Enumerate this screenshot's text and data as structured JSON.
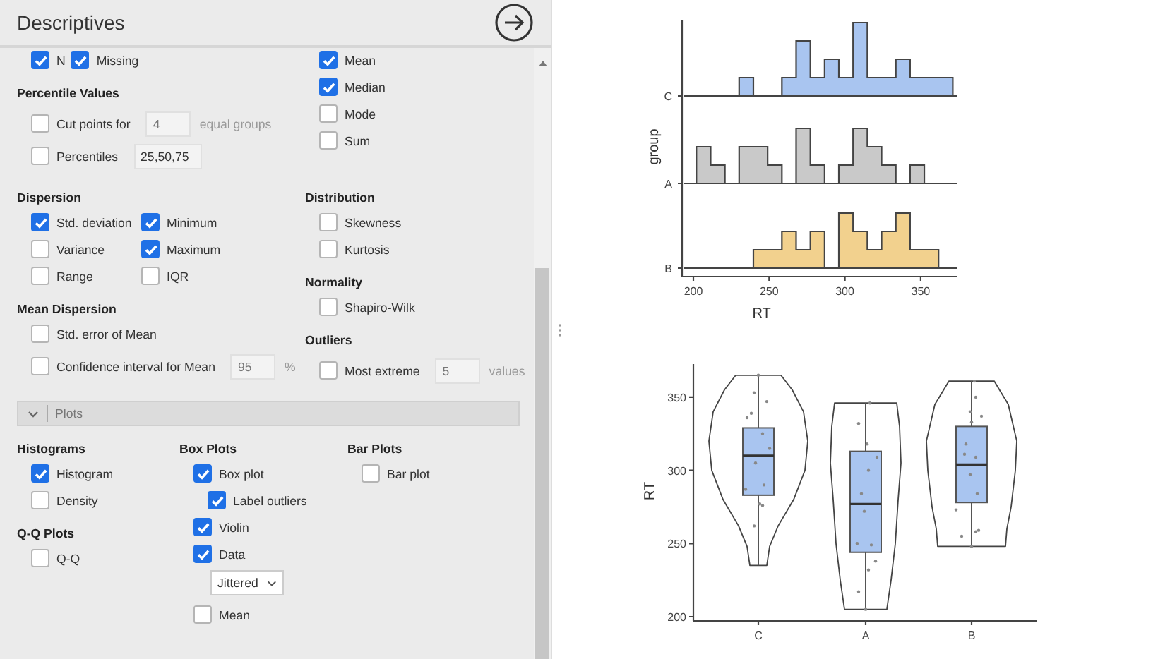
{
  "panel": {
    "title": "Descriptives",
    "option_groups": [
      {
        "columns": [
          [
            {
              "kind": "inline",
              "checks": [
                {
                  "label": "N",
                  "checked": true
                },
                {
                  "label": "Missing",
                  "checked": true
                }
              ]
            },
            {
              "kind": "heading",
              "label": "Percentile Values"
            },
            {
              "kind": "check",
              "label": "Cut points for",
              "checked": false,
              "field": {
                "value": "4",
                "disabled": true
              },
              "suffix": "equal groups"
            },
            {
              "kind": "check",
              "label": "Percentiles",
              "checked": false,
              "field": {
                "value": "25,50,75",
                "disabled": false
              }
            }
          ],
          [
            {
              "kind": "check",
              "label": "Mean",
              "checked": true
            },
            {
              "kind": "check",
              "label": "Median",
              "checked": true
            },
            {
              "kind": "check",
              "label": "Mode",
              "checked": false
            },
            {
              "kind": "check",
              "label": "Sum",
              "checked": false
            }
          ]
        ]
      },
      {
        "columns": [
          [
            {
              "kind": "heading",
              "label": "Dispersion"
            },
            {
              "kind": "pair",
              "checks": [
                {
                  "label": "Std. deviation",
                  "checked": true
                },
                {
                  "label": "Minimum",
                  "checked": true
                }
              ]
            },
            {
              "kind": "pair",
              "checks": [
                {
                  "label": "Variance",
                  "checked": false
                },
                {
                  "label": "Maximum",
                  "checked": true
                }
              ]
            },
            {
              "kind": "pair",
              "checks": [
                {
                  "label": "Range",
                  "checked": false
                },
                {
                  "label": "IQR",
                  "checked": false
                }
              ]
            },
            {
              "kind": "heading",
              "label": "Mean Dispersion"
            },
            {
              "kind": "check",
              "label": "Std. error of Mean",
              "checked": false
            },
            {
              "kind": "check",
              "label": "Confidence interval for Mean",
              "checked": false,
              "field": {
                "value": "95",
                "disabled": true
              },
              "suffix": "%"
            }
          ],
          [
            {
              "kind": "heading",
              "label": "Distribution"
            },
            {
              "kind": "check",
              "label": "Skewness",
              "checked": false
            },
            {
              "kind": "check",
              "label": "Kurtosis",
              "checked": false
            },
            {
              "kind": "heading",
              "label": "Normality"
            },
            {
              "kind": "check",
              "label": "Shapiro-Wilk",
              "checked": false
            },
            {
              "kind": "heading",
              "label": "Outliers"
            },
            {
              "kind": "check",
              "label": "Most extreme",
              "checked": false,
              "field": {
                "value": "5",
                "disabled": true
              },
              "suffix": "values"
            }
          ]
        ]
      }
    ],
    "plots_section": {
      "label": "Plots",
      "expanded": true,
      "columns": [
        [
          {
            "kind": "heading",
            "label": "Histograms"
          },
          {
            "kind": "check",
            "label": "Histogram",
            "checked": true
          },
          {
            "kind": "check",
            "label": "Density",
            "checked": false
          },
          {
            "kind": "heading",
            "label": "Q-Q Plots"
          },
          {
            "kind": "check",
            "label": "Q-Q",
            "checked": false
          }
        ],
        [
          {
            "kind": "heading",
            "label": "Box Plots"
          },
          {
            "kind": "check",
            "label": "Box plot",
            "checked": true,
            "children": [
              {
                "kind": "check",
                "label": "Label outliers",
                "checked": true
              }
            ]
          },
          {
            "kind": "check",
            "label": "Violin",
            "checked": true
          },
          {
            "kind": "check",
            "label": "Data",
            "checked": true
          },
          {
            "kind": "select",
            "value": "Jittered"
          },
          {
            "kind": "check",
            "label": "Mean",
            "checked": false
          }
        ],
        [
          {
            "kind": "heading",
            "label": "Bar Plots"
          },
          {
            "kind": "check",
            "label": "Bar plot",
            "checked": false
          }
        ]
      ]
    }
  },
  "histogram_plot": {
    "xlabel": "RT",
    "ylabel": "group",
    "xticks": [
      "200",
      "250",
      "300",
      "350"
    ],
    "groups": [
      {
        "label": "C",
        "color": "#a9c5f0"
      },
      {
        "label": "A",
        "color": "#c9c9c9"
      },
      {
        "label": "B",
        "color": "#f2d18e"
      }
    ]
  },
  "box_plot": {
    "ylabel": "RT",
    "yticks": [
      "350",
      "300",
      "250",
      "200"
    ],
    "categories": [
      "C",
      "A",
      "B"
    ]
  }
}
